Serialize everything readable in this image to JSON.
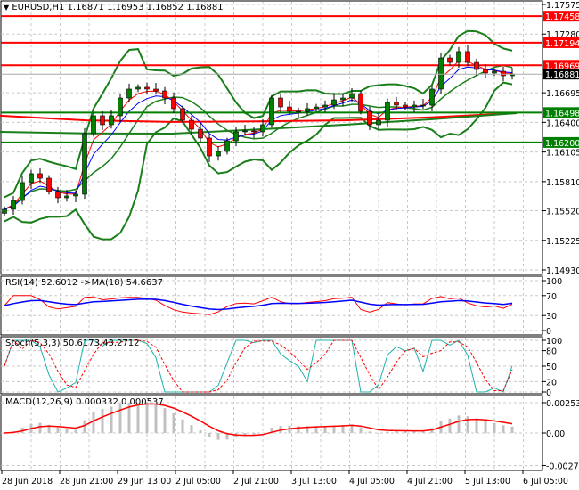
{
  "header": {
    "symbol": "EURUSD,H1",
    "open": "1.16871",
    "high": "1.16953",
    "low": "1.16852",
    "close": "1.16881",
    "menu_icon": "triangle-down-icon"
  },
  "indicators": {
    "rsi_label": "RSI(14) 52.6012  ->MA(18) 54.6637",
    "stoch_label": "Stoch(5,3,3) 50.6173 43.2712",
    "macd_label": "MACD(12,26,9) 0.000332 0.000537"
  },
  "colors": {
    "bull": "#008000",
    "bear": "#ff0000",
    "bands": "#1a7f1a",
    "rsi": "#ff0000",
    "rsi_ma": "#0000ff",
    "stoch_main": "#20b2aa",
    "stoch_signal": "#ff0000",
    "macd_signal": "#ff0000",
    "macd_hist": "#c0c0c0"
  },
  "chart_data": [
    {
      "type": "candlestick",
      "title": "EURUSD,H1",
      "ylim": [
        1.1493,
        1.17575
      ],
      "y_ticks": [
        "1.17575",
        "1.17280",
        "1.16695",
        "1.16400",
        "1.16105",
        "1.15810",
        "1.15520",
        "1.15225",
        "1.14930"
      ],
      "x_ticks": [
        "28 Jun 2018",
        "28 Jun 21:00",
        "29 Jun 13:00",
        "2 Jul 05:00",
        "2 Jul 21:00",
        "3 Jul 13:00",
        "4 Jul 05:00",
        "4 Jul 21:00",
        "5 Jul 13:00",
        "6 Jul 05:00"
      ],
      "closes": [
        1.15534,
        1.15622,
        1.158,
        1.15889,
        1.15844,
        1.15711,
        1.15649,
        1.15667,
        1.15685,
        1.16288,
        1.16466,
        1.16377,
        1.16466,
        1.16643,
        1.16732,
        1.1675,
        1.16732,
        1.16714,
        1.16643,
        1.16537,
        1.16421,
        1.16332,
        1.16244,
        1.16066,
        1.16111,
        1.16217,
        1.16306,
        1.16315,
        1.16306,
        1.16377,
        1.16643,
        1.16554,
        1.1651,
        1.1651,
        1.16537,
        1.16554,
        1.16572,
        1.16625,
        1.16643,
        1.16687,
        1.1651,
        1.16377,
        1.16421,
        1.16599,
        1.16572,
        1.16554,
        1.16572,
        1.16572,
        1.16732,
        1.17042,
        1.16998,
        1.17105,
        1.16998,
        1.16927,
        1.16892,
        1.16909,
        1.16865,
        1.16881
      ],
      "ma_long_red": [
        1.16466,
        1.1642,
        1.16404,
        1.1641,
        1.1642,
        1.1645,
        1.16492
      ],
      "ma_long_green": [
        1.16306,
        1.1629,
        1.16288,
        1.1633,
        1.16377,
        1.1643,
        1.16492
      ],
      "levels": [
        {
          "price": "1.17458",
          "kind": "resistance"
        },
        {
          "price": "1.17194",
          "kind": "resistance"
        },
        {
          "price": "1.16969",
          "kind": "resistance"
        },
        {
          "price": "1.16498",
          "kind": "support"
        },
        {
          "price": "1.16200",
          "kind": "support"
        }
      ],
      "current_price": "1.16881"
    },
    {
      "type": "line",
      "title": "RSI(14)",
      "ylim": [
        0,
        100
      ],
      "y_ticks": [
        "100",
        "70",
        "30",
        "0"
      ],
      "value": 52.6012,
      "ma": 54.6637
    },
    {
      "type": "line",
      "title": "Stoch(5,3,3)",
      "ylim": [
        0,
        100
      ],
      "y_ticks": [
        "100",
        "80",
        "50",
        "20",
        "0"
      ],
      "main": 50.6173,
      "signal": 43.2712
    },
    {
      "type": "bar",
      "title": "MACD(12,26,9)",
      "ylim": [
        -0.002723,
        0.002539
      ],
      "y_ticks": [
        "0.002539",
        "0.00",
        "-0.002723"
      ],
      "macd": 0.000332,
      "signal": 0.000537
    }
  ]
}
